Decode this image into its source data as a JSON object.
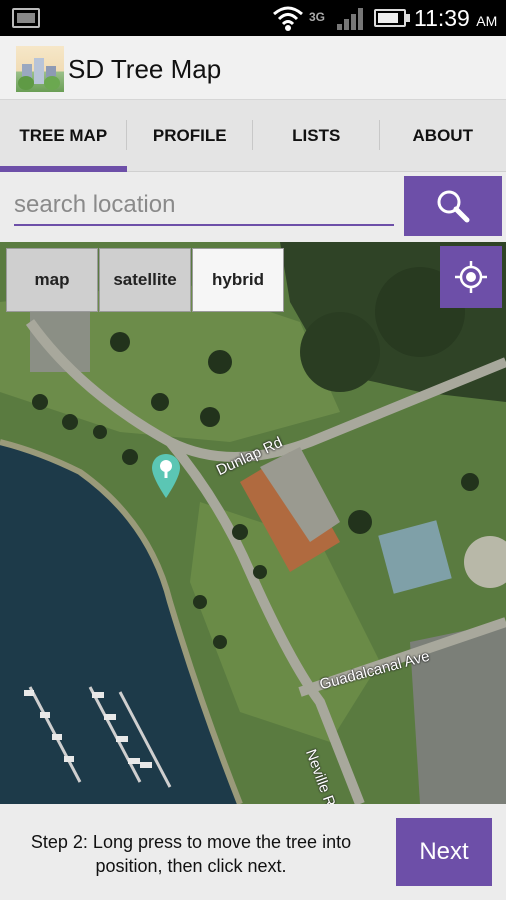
{
  "status_bar": {
    "network": "3G",
    "time": "11:39",
    "ampm": "AM",
    "battery_level": 0.85,
    "icons": [
      "screenshot-icon",
      "wifi-icon",
      "signal-icon",
      "battery-icon"
    ]
  },
  "app": {
    "title": "SD Tree Map",
    "logo_icon": "city-trees-logo"
  },
  "tabs": [
    {
      "label": "TREE MAP",
      "active": true
    },
    {
      "label": "PROFILE",
      "active": false
    },
    {
      "label": "LISTS",
      "active": false
    },
    {
      "label": "ABOUT",
      "active": false
    }
  ],
  "search": {
    "placeholder": "search location",
    "value": "",
    "button_icon": "search-icon"
  },
  "map": {
    "types": [
      {
        "label": "map",
        "selected": false
      },
      {
        "label": "satellite",
        "selected": false
      },
      {
        "label": "hybrid",
        "selected": true
      }
    ],
    "locate_icon": "my-location-icon",
    "roads": [
      "Dunlap Rd",
      "Guadalcanal Ave",
      "Neville Rd"
    ],
    "marker_icon": "tree-marker-icon"
  },
  "footer": {
    "instruction": "Step 2: Long press to move the tree into position, then click next.",
    "next_label": "Next"
  },
  "colors": {
    "accent": "#6d4fa8",
    "water": "#1f3c4a",
    "grass": "#5d7d44",
    "marker": "#5bc6b4"
  }
}
